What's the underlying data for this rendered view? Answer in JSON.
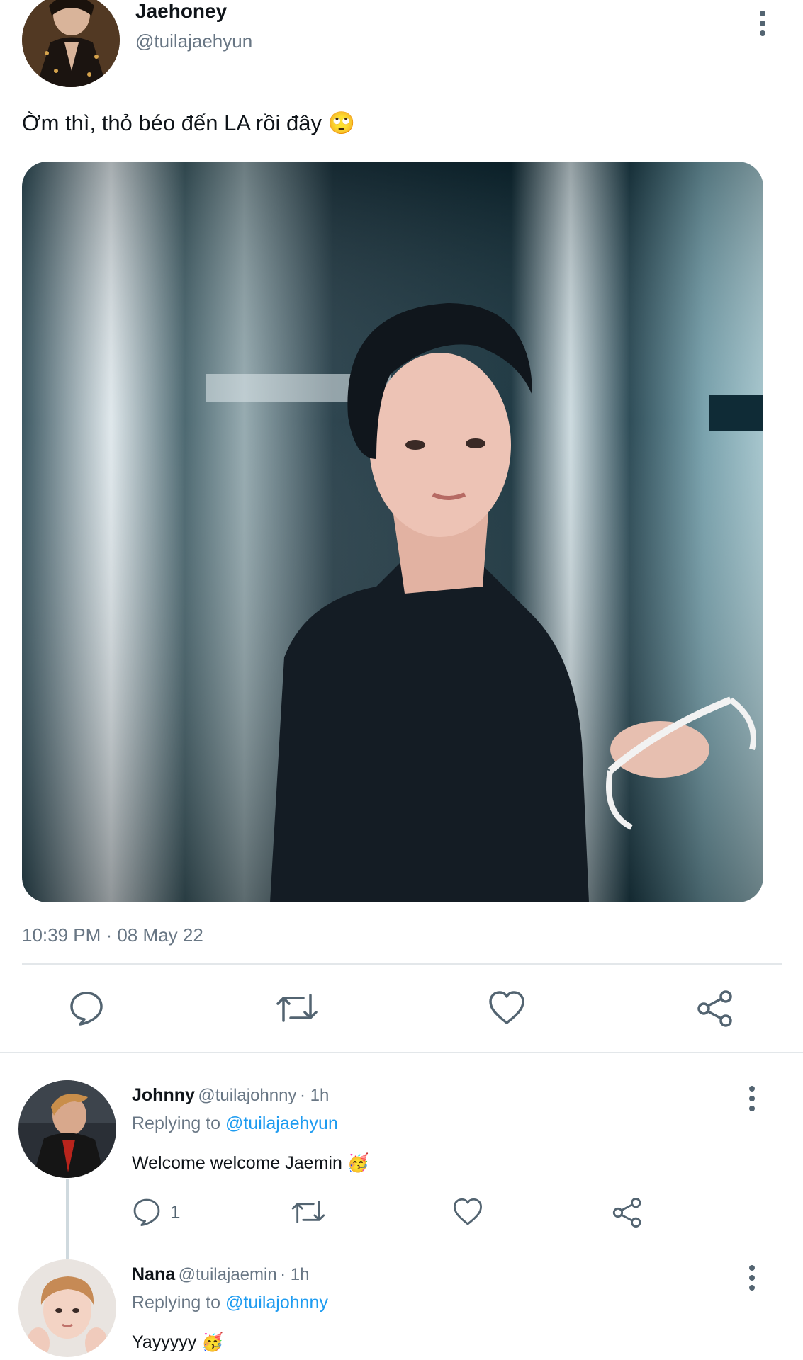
{
  "tweet": {
    "author_name": "Jaehoney",
    "author_handle": "@tuilajaehyun",
    "text": "Ờm thì, thỏ béo đến LA rồi đây",
    "text_emoji": "🙄",
    "timestamp": "10:39 PM · 08 May 22",
    "actions": [
      "reply-icon",
      "retweet-icon",
      "like-icon",
      "share-icon"
    ]
  },
  "replies": [
    {
      "name": "Johnny",
      "handle": "@tuilajohnny",
      "time": "· 1h",
      "replying_prefix": "Replying to",
      "replying_to": "@tuilajaehyun",
      "text": "Welcome welcome Jaemin",
      "emoji": "🥳",
      "reply_count": "1"
    },
    {
      "name": "Nana",
      "handle": "@tuilajaemin",
      "time": "· 1h",
      "replying_prefix": "Replying to",
      "replying_to": "@tuilajohnny",
      "text": "Yayyyyy",
      "emoji": "🥳"
    }
  ],
  "colors": {
    "text": "#0f1419",
    "secondary": "#687684",
    "link": "#1d9bf0",
    "divider": "#e3e7ea"
  }
}
